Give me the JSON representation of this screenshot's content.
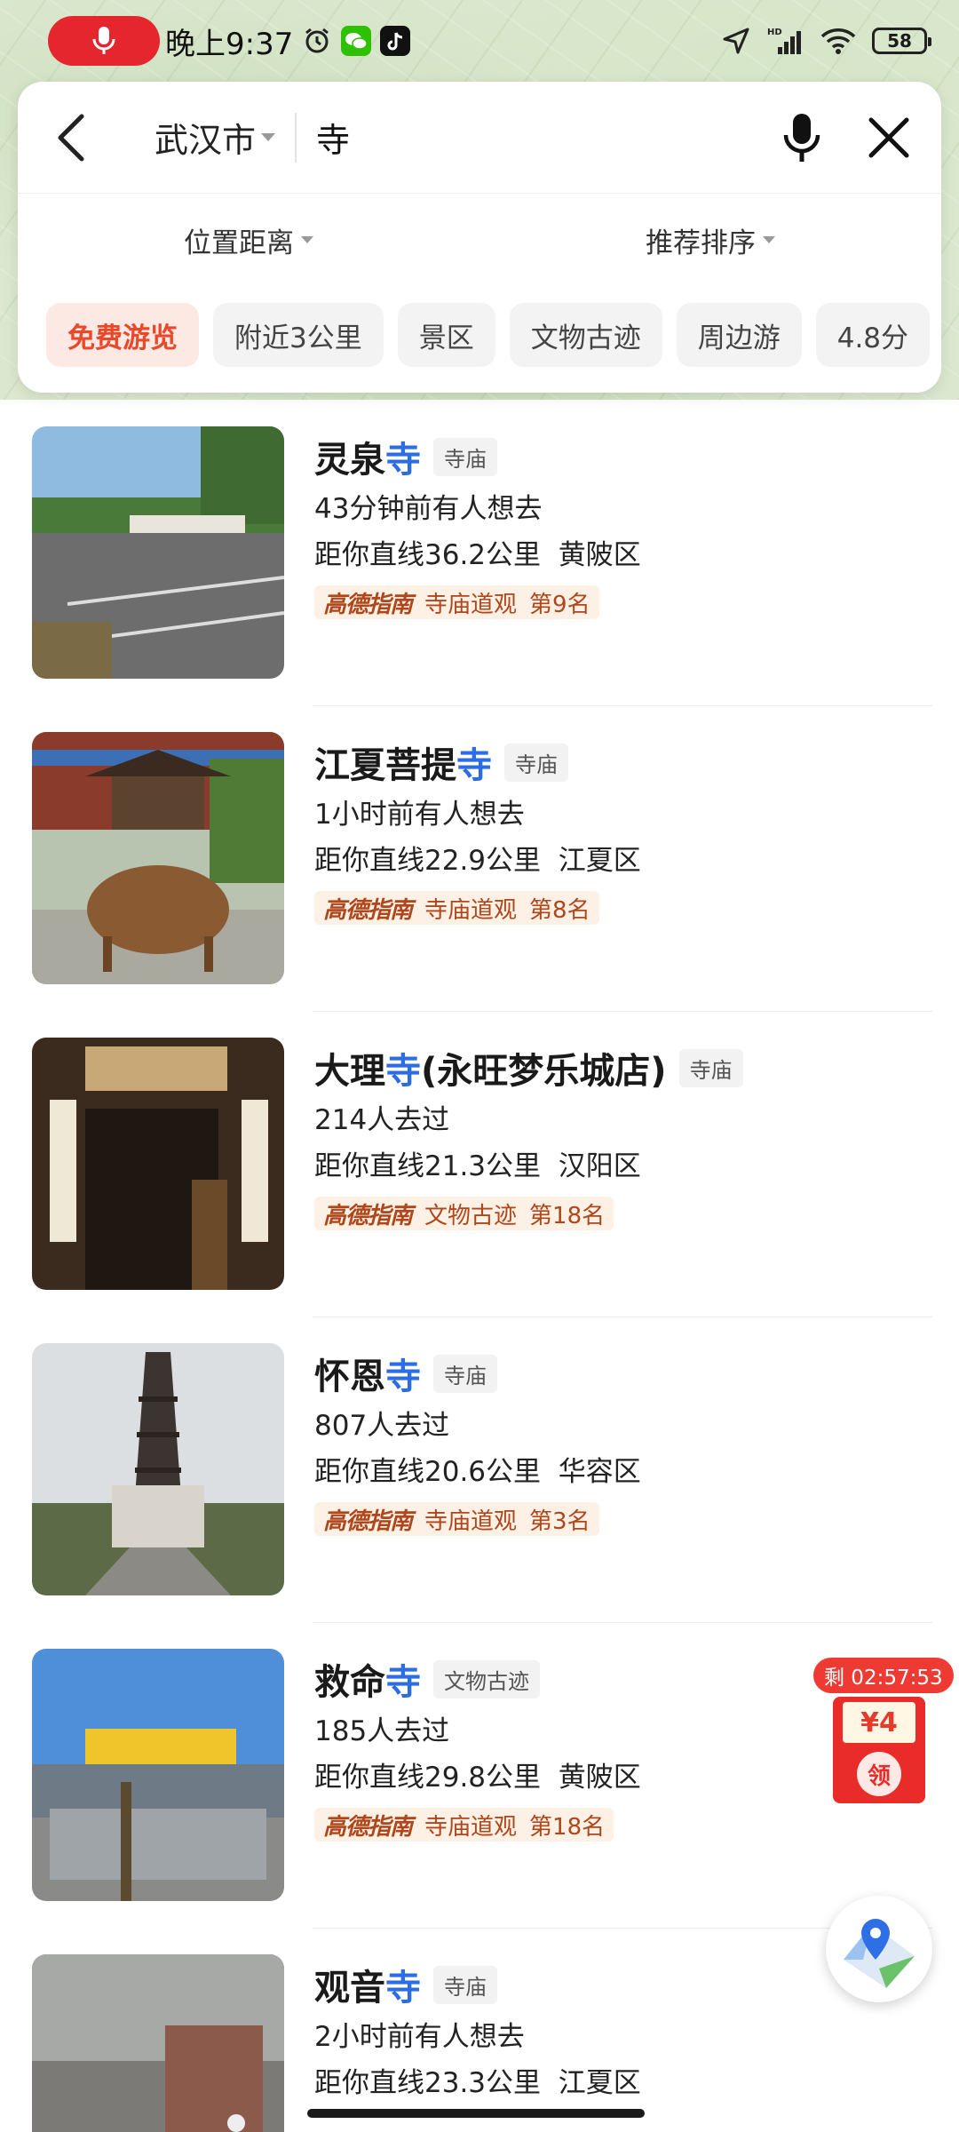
{
  "status_bar": {
    "time": "晚上9:37",
    "battery": "58",
    "icons": [
      "mic-recording-icon",
      "alarm-icon",
      "wechat-icon",
      "tiktok-icon",
      "location-arrow-icon",
      "hd-signal-icon",
      "wifi-icon",
      "battery-icon"
    ]
  },
  "search": {
    "city": "武汉市",
    "query": "寺"
  },
  "filters": {
    "distance": "位置距离",
    "sort": "推荐排序"
  },
  "chips": [
    "免费游览",
    "附近3公里",
    "景区",
    "文物古迹",
    "周边游",
    "4.8分"
  ],
  "results": [
    {
      "name_prefix": "灵泉",
      "name_hl": "寺",
      "name_suffix": "",
      "tag": "寺庙",
      "activity": "43分钟前有人想去",
      "distance": "距你直线36.2公里",
      "district": "黄陂区",
      "guide": "高德指南",
      "rank_category": "寺庙道观",
      "rank": "第9名"
    },
    {
      "name_prefix": "江夏菩提",
      "name_hl": "寺",
      "name_suffix": "",
      "tag": "寺庙",
      "activity": "1小时前有人想去",
      "distance": "距你直线22.9公里",
      "district": "江夏区",
      "guide": "高德指南",
      "rank_category": "寺庙道观",
      "rank": "第8名"
    },
    {
      "name_prefix": "大理",
      "name_hl": "寺",
      "name_suffix": "(永旺梦乐城店)",
      "tag": "寺庙",
      "activity": "214人去过",
      "distance": "距你直线21.3公里",
      "district": "汉阳区",
      "guide": "高德指南",
      "rank_category": "文物古迹",
      "rank": "第18名"
    },
    {
      "name_prefix": "怀恩",
      "name_hl": "寺",
      "name_suffix": "",
      "tag": "寺庙",
      "activity": "807人去过",
      "distance": "距你直线20.6公里",
      "district": "华容区",
      "guide": "高德指南",
      "rank_category": "寺庙道观",
      "rank": "第3名"
    },
    {
      "name_prefix": "救命",
      "name_hl": "寺",
      "name_suffix": "",
      "tag": "文物古迹",
      "activity": "185人去过",
      "distance": "距你直线29.8公里",
      "district": "黄陂区",
      "guide": "高德指南",
      "rank_category": "寺庙道观",
      "rank": "第18名"
    },
    {
      "name_prefix": "观音",
      "name_hl": "寺",
      "name_suffix": "",
      "tag": "寺庙",
      "activity": "2小时前有人想去",
      "distance": "距你直线23.3公里",
      "district": "江夏区",
      "guide": "",
      "rank_category": "",
      "rank": ""
    }
  ],
  "coupon": {
    "timer": "剩 02:57:53",
    "amount": "¥4",
    "claim": "领"
  },
  "colors": {
    "highlight": "#2c6de6",
    "chip_active": "#e8492b",
    "rank": "#b0461b",
    "coupon": "#e92b2a"
  }
}
